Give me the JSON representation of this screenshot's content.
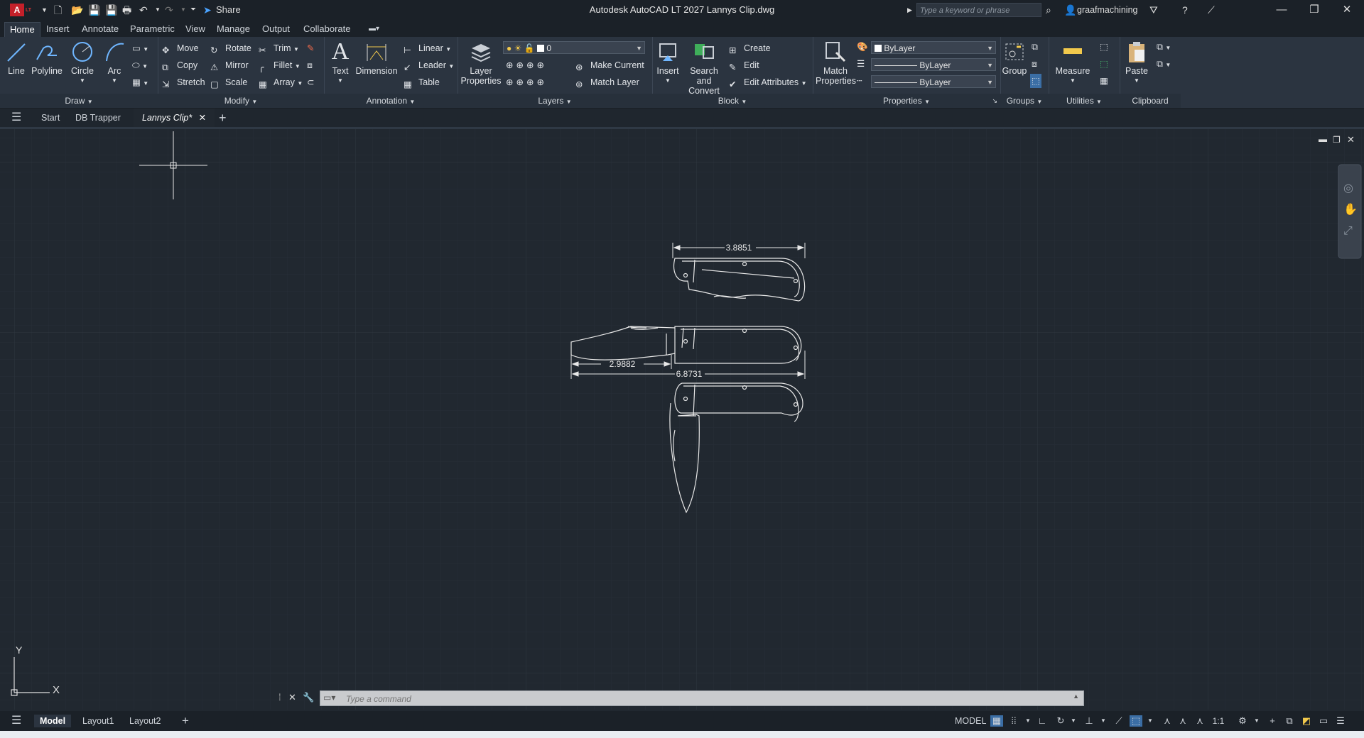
{
  "window": {
    "title": "Autodesk AutoCAD LT 2027    Lannys Clip.dwg",
    "app_badge": "LT",
    "share_label": "Share",
    "search_placeholder": "Type a keyword or phrase",
    "user": "graafmachining"
  },
  "ribbon_tabs": [
    "Home",
    "Insert",
    "Annotate",
    "Parametric",
    "View",
    "Manage",
    "Output",
    "Collaborate"
  ],
  "ribbon": {
    "draw": {
      "title": "Draw",
      "line": "Line",
      "polyline": "Polyline",
      "circle": "Circle",
      "arc": "Arc"
    },
    "modify": {
      "title": "Modify",
      "move": "Move",
      "rotate": "Rotate",
      "trim": "Trim",
      "copy": "Copy",
      "mirror": "Mirror",
      "fillet": "Fillet",
      "stretch": "Stretch",
      "scale": "Scale",
      "array": "Array"
    },
    "annotation": {
      "title": "Annotation",
      "text": "Text",
      "dimension": "Dimension",
      "linear": "Linear",
      "leader": "Leader",
      "table": "Table"
    },
    "layers": {
      "title": "Layers",
      "layer_properties": "Layer Properties",
      "current_layer": "0",
      "make_current": "Make Current",
      "match_layer": "Match Layer"
    },
    "block": {
      "title": "Block",
      "insert": "Insert",
      "search_convert": "Search and Convert",
      "create": "Create",
      "edit": "Edit",
      "edit_attributes": "Edit Attributes"
    },
    "properties": {
      "title": "Properties",
      "match_properties": "Match Properties",
      "color": "ByLayer",
      "linetype": "ByLayer",
      "lineweight": "ByLayer"
    },
    "groups": {
      "title": "Groups",
      "group": "Group"
    },
    "utilities": {
      "title": "Utilities",
      "measure": "Measure"
    },
    "clipboard": {
      "title": "Clipboard",
      "paste": "Paste"
    }
  },
  "file_tabs": [
    "Start",
    "DB Trapper",
    "Lannys Clip*"
  ],
  "drawing": {
    "dim_top": "3.8851",
    "dim_blade": "2.9882",
    "dim_overall": "6.8731",
    "ucs_x": "X",
    "ucs_y": "Y"
  },
  "command_line": {
    "placeholder": "Type a command"
  },
  "layout_tabs": [
    "Model",
    "Layout1",
    "Layout2"
  ],
  "status": {
    "mode": "MODEL",
    "scale": "1:1"
  },
  "colors": {
    "background": "#212830",
    "ribbon": "#2b3440",
    "grid": "#2a323c",
    "accent_red": "#c5202a",
    "selection_blue": "#4a90d9"
  }
}
